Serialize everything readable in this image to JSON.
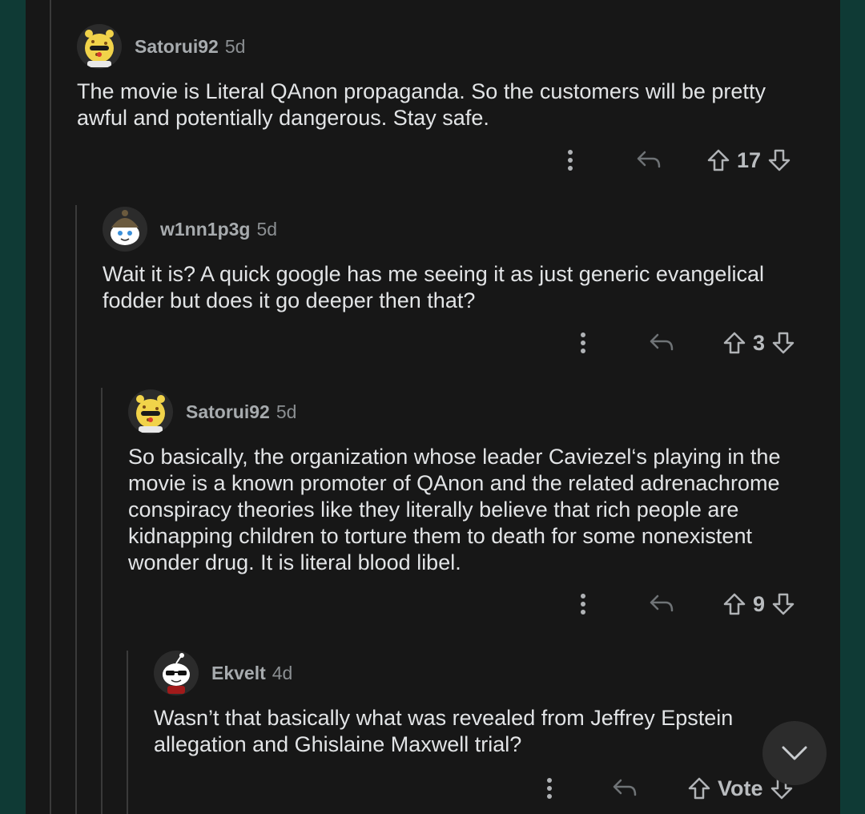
{
  "comments": [
    {
      "username": "Satorui92",
      "age": "5d",
      "avatar_icon": "cheetah-snoo-avatar-icon",
      "body": "The movie is Literal QAnon propaganda. So the customers will be pretty\nawful and potentially dangerous. Stay safe.",
      "score": "17"
    },
    {
      "username": "w1nn1p3g",
      "age": "5d",
      "avatar_icon": "beanie-snoo-avatar-icon",
      "body": "Wait it is? A quick google has me seeing it as just generic evangelical\nfodder but does it go deeper then that?",
      "score": "3"
    },
    {
      "username": "Satorui92",
      "age": "5d",
      "avatar_icon": "cheetah-snoo-avatar-icon",
      "body": "So basically, the organization whose leader  Caviezel‘s playing in the\nmovie is a known promoter of QAnon and the related adrenachrome\nconspiracy theories like they literally believe that rich people are\nkidnapping children to torture them to death for some nonexistent\nwonder drug. It is literal blood libel.",
      "score": "9"
    },
    {
      "username": "Ekvelt",
      "age": "4d",
      "avatar_icon": "sunglasses-snoo-avatar-icon",
      "body": "Wasn’t that basically what was revealed from Jeffrey Epstein\nallegation and Ghislaine Maxwell trial?",
      "score": "Vote"
    }
  ],
  "icons": {
    "more": "more-options-icon",
    "reply": "reply-icon",
    "upvote": "upvote-arrow-icon",
    "downvote": "downvote-arrow-icon",
    "scroll": "chevron-down-icon"
  },
  "colors": {
    "background": "#0f3a35",
    "panel": "#171717",
    "text": "#e2e4e6",
    "muted": "#8b8f92"
  }
}
